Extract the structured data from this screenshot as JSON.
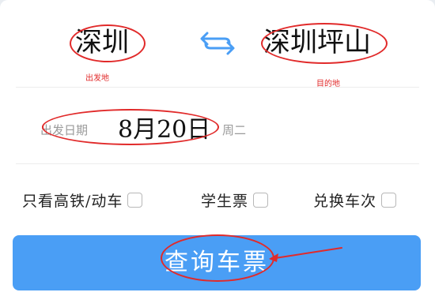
{
  "route": {
    "from_city": "深圳",
    "to_city": "深圳坪山",
    "from_annotation": "出发地",
    "to_annotation": "目的地",
    "swap_icon": "swap-arrows-icon"
  },
  "date": {
    "label": "出发日期",
    "value": "8月20日",
    "weekday": "周二"
  },
  "options": [
    {
      "label": "只看高铁/动车",
      "checked": false
    },
    {
      "label": "学生票",
      "checked": false
    },
    {
      "label": "兑换车次",
      "checked": false
    }
  ],
  "search": {
    "label": "查询车票"
  },
  "colors": {
    "accent": "#4a9ef5",
    "annotation": "#e12a2a",
    "muted_text": "#9a9a9a",
    "background": "#e9edf1"
  }
}
